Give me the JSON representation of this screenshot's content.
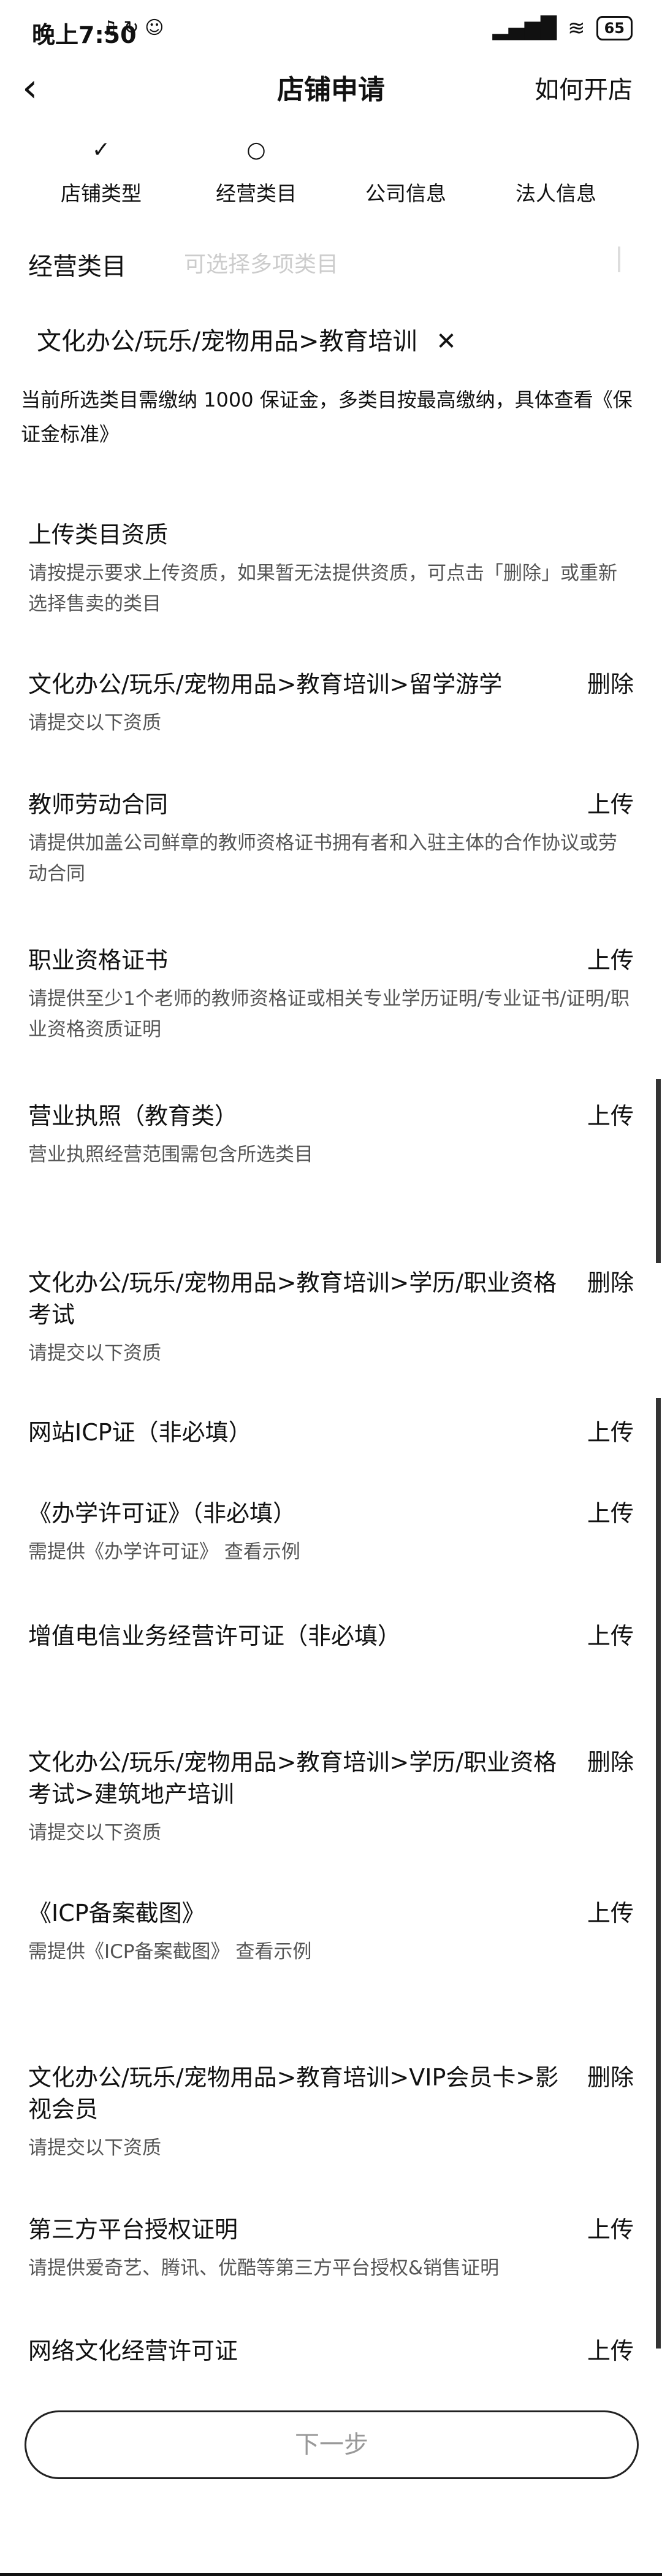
{
  "status": {
    "time": "晚上7:50",
    "status_icons": "♫ ↻ ☺",
    "signal": "▂▄▆█",
    "wifi": "≋",
    "battery": "65"
  },
  "nav": {
    "title": "店铺申请",
    "how": "如何开店"
  },
  "steps": [
    {
      "label": "店铺类型",
      "icon": "✓"
    },
    {
      "label": "经营类目",
      "icon": "○"
    },
    {
      "label": "公司信息",
      "icon": ""
    },
    {
      "label": "法人信息",
      "icon": ""
    }
  ],
  "category": {
    "label": "经营类目",
    "placeholder": "可选择多项类目",
    "selected": "文化办公/玩乐/宠物用品>教育培训",
    "remove_icon": "✕",
    "notice": "当前所选类目需缴纳 1000 保证金，多类目按最高缴纳，具体查看《保证金标准》"
  },
  "upload": {
    "title": "上传类目资质",
    "desc": "请按提示要求上传资质，如果暂无法提供资质，可点击「删除」或重新选择售卖的类目"
  },
  "groups": [
    {
      "title": "文化办公/玩乐/宠物用品>教育培训>留学游学",
      "action": "删除",
      "hint": "请提交以下资质",
      "items": [
        {
          "title": "教师劳动合同",
          "action": "上传",
          "desc": "请提供加盖公司鲜章的教师资格证书拥有者和入驻主体的合作协议或劳动合同"
        },
        {
          "title": "职业资格证书",
          "action": "上传",
          "desc": "请提供至少1个老师的教师资格证或相关专业学历证明/专业证书/证明/职业资格资质证明"
        },
        {
          "title": "营业执照（教育类）",
          "action": "上传",
          "desc": "营业执照经营范围需包含所选类目"
        }
      ]
    },
    {
      "title": "文化办公/玩乐/宠物用品>教育培训>学历/职业资格考试",
      "action": "删除",
      "hint": "请提交以下资质",
      "items": [
        {
          "title": "网站ICP证（非必填）",
          "action": "上传",
          "desc": ""
        },
        {
          "title": "《办学许可证》（非必填）",
          "action": "上传",
          "desc": "需提供《办学许可证》  查看示例"
        },
        {
          "title": "增值电信业务经营许可证（非必填）",
          "action": "上传",
          "desc": ""
        }
      ]
    },
    {
      "title": "文化办公/玩乐/宠物用品>教育培训>学历/职业资格考试>建筑地产培训",
      "action": "删除",
      "hint": "请提交以下资质",
      "items": [
        {
          "title": "《ICP备案截图》",
          "action": "上传",
          "desc": "需提供《ICP备案截图》  查看示例"
        }
      ]
    },
    {
      "title": "文化办公/玩乐/宠物用品>教育培训>VIP会员卡>影视会员",
      "action": "删除",
      "hint": "请提交以下资质",
      "items": [
        {
          "title": "第三方平台授权证明",
          "action": "上传",
          "desc": "请提供爱奇艺、腾讯、优酷等第三方平台授权&销售证明"
        },
        {
          "title": "网络文化经营许可证",
          "action": "上传",
          "desc": ""
        }
      ]
    }
  ],
  "next_button": "下一步"
}
